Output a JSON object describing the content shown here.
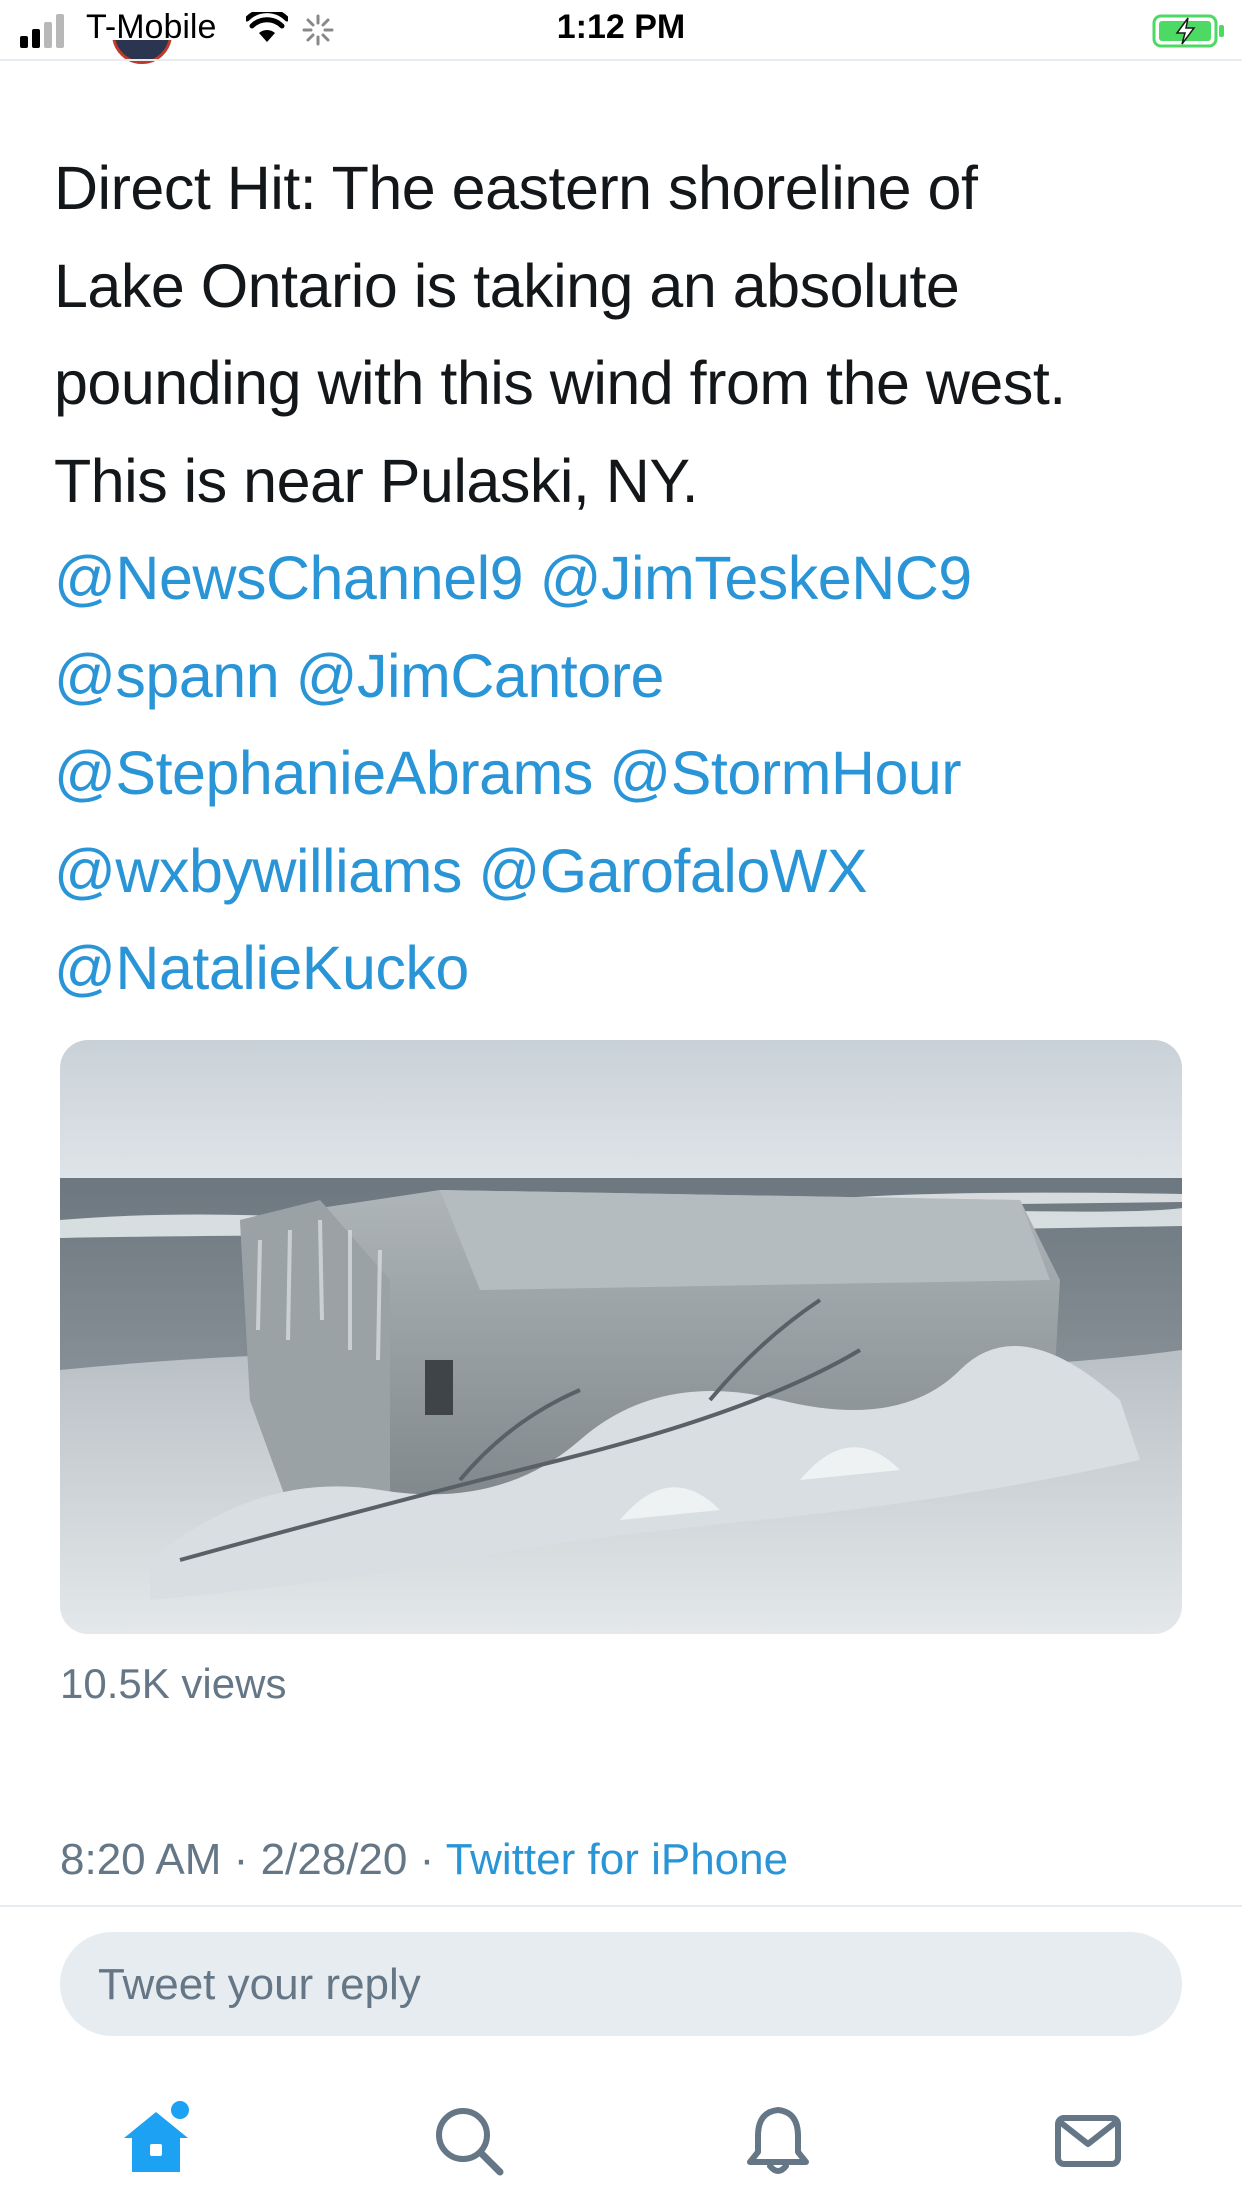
{
  "status_bar": {
    "carrier": "T-Mobile",
    "time": "1:12 PM",
    "battery_state": "charging"
  },
  "tweet": {
    "lines": [
      {
        "parts": [
          {
            "text": "Direct Hit:  The eastern shoreline of",
            "type": "text"
          }
        ]
      },
      {
        "parts": [
          {
            "text": "Lake Ontario is taking an absolute",
            "type": "text"
          }
        ]
      },
      {
        "parts": [
          {
            "text": "pounding with this wind from the west.",
            "type": "text"
          }
        ]
      },
      {
        "parts": [
          {
            "text": "This is near Pulaski, NY.",
            "type": "text"
          }
        ]
      },
      {
        "parts": [
          {
            "text": "@NewsChannel9",
            "type": "mention"
          },
          {
            "text": " ",
            "type": "text"
          },
          {
            "text": "@JimTeskeNC9",
            "type": "mention"
          }
        ]
      },
      {
        "parts": [
          {
            "text": "@spann",
            "type": "mention"
          },
          {
            "text": " ",
            "type": "text"
          },
          {
            "text": "@JimCantore",
            "type": "mention"
          }
        ]
      },
      {
        "parts": [
          {
            "text": "@StephanieAbrams",
            "type": "mention"
          },
          {
            "text": " ",
            "type": "text"
          },
          {
            "text": "@StormHour",
            "type": "mention"
          }
        ]
      },
      {
        "parts": [
          {
            "text": "@wxbywilliams",
            "type": "mention"
          },
          {
            "text": " ",
            "type": "text"
          },
          {
            "text": "@GarofaloWX",
            "type": "mention"
          }
        ]
      },
      {
        "parts": [
          {
            "text": "@NatalieKucko",
            "type": "mention"
          }
        ]
      }
    ],
    "views": "10.5K views",
    "time": "8:20 AM",
    "separator": "·",
    "date": "2/28/20",
    "source": "Twitter for iPhone"
  },
  "reply": {
    "placeholder": "Tweet your reply"
  },
  "tab_bar": {
    "items": [
      {
        "icon": "home-icon",
        "active": true
      },
      {
        "icon": "search-icon",
        "active": false
      },
      {
        "icon": "bell-icon",
        "active": false
      },
      {
        "icon": "mail-icon",
        "active": false
      }
    ]
  },
  "colors": {
    "link": "#2a95d6",
    "secondary_text": "#657786",
    "primary_text": "#14171a",
    "reply_bg": "#e6ecf0",
    "active_tab": "#1da1f2"
  }
}
